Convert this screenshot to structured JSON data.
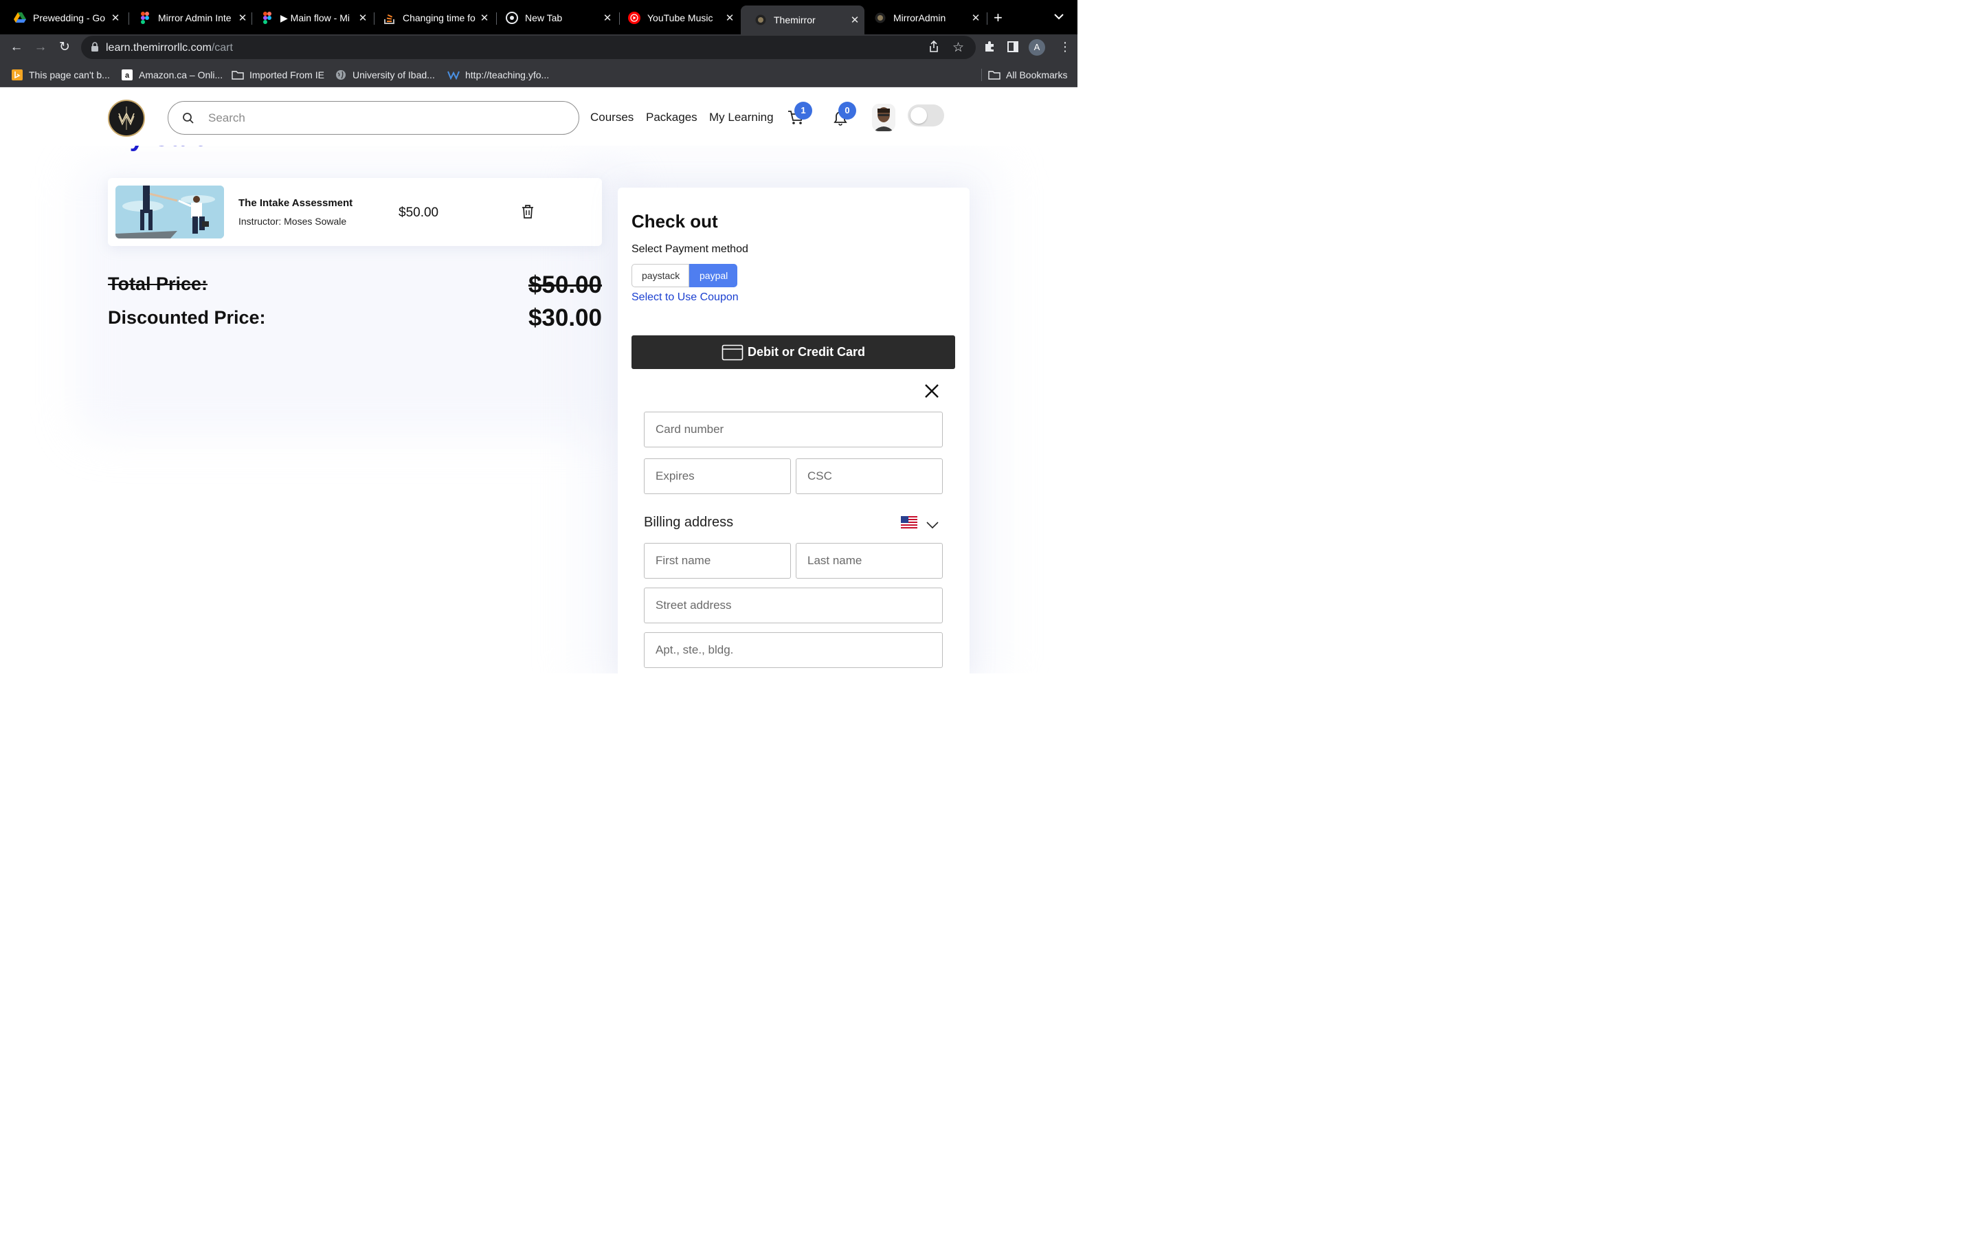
{
  "browser": {
    "tabs": [
      {
        "title": "Prewedding - Go",
        "icon": "google-drive-icon"
      },
      {
        "title": "Mirror Admin Inte",
        "icon": "figma-icon"
      },
      {
        "title": "▶ Main flow - Mi",
        "icon": "figma-icon"
      },
      {
        "title": "Changing time fo",
        "icon": "stackoverflow-icon"
      },
      {
        "title": "New Tab",
        "icon": "chrome-icon"
      },
      {
        "title": "YouTube Music",
        "icon": "youtube-music-icon"
      },
      {
        "title": "Themirror",
        "icon": "themirror-icon"
      },
      {
        "title": "MirrorAdmin",
        "icon": "themirror-icon"
      }
    ],
    "address": {
      "host": "learn.themirrorllc.com",
      "path": "/cart"
    },
    "profile_initial": "A",
    "bookmarks": [
      {
        "label": "This page can't b...",
        "icon": "bing-icon"
      },
      {
        "label": "Amazon.ca – Onli...",
        "icon": "amazon-icon"
      },
      {
        "label": "Imported From IE",
        "icon": "folder-icon"
      },
      {
        "label": "University of Ibad...",
        "icon": "globe-icon"
      },
      {
        "label": "http://teaching.yfo...",
        "icon": "weebly-icon"
      }
    ],
    "all_bookmarks": "All Bookmarks"
  },
  "header": {
    "search_placeholder": "Search",
    "nav": [
      "Courses",
      "Packages",
      "My Learning"
    ],
    "cart_count": "1",
    "notification_count": "0"
  },
  "page_title": "My Cart",
  "cart": {
    "items": [
      {
        "title": "The Intake Assessment",
        "instructor": "Instructor: Moses Sowale",
        "price": "$50.00"
      }
    ],
    "total_label": "Total Price:",
    "total_value": "$50.00",
    "discount_label": "Discounted Price:",
    "discount_value": "$30.00"
  },
  "checkout": {
    "title": "Check out",
    "payment_label": "Select Payment method",
    "methods": [
      "paystack",
      "paypal"
    ],
    "selected_method": "paypal",
    "coupon_link": "Select to Use Coupon",
    "card_button": "Debit or Credit Card",
    "fields": {
      "card_number": "Card number",
      "expires": "Expires",
      "csc": "CSC",
      "first_name": "First name",
      "last_name": "Last name",
      "street": "Street address",
      "apt": "Apt., ste., bldg."
    },
    "billing_label": "Billing address"
  },
  "colors": {
    "accent": "#4f7ef0",
    "badge": "#3b6fe0",
    "title_blue": "#1c1ccf",
    "link_blue": "#1a3fd0",
    "card_button": "#2b2b2b"
  }
}
